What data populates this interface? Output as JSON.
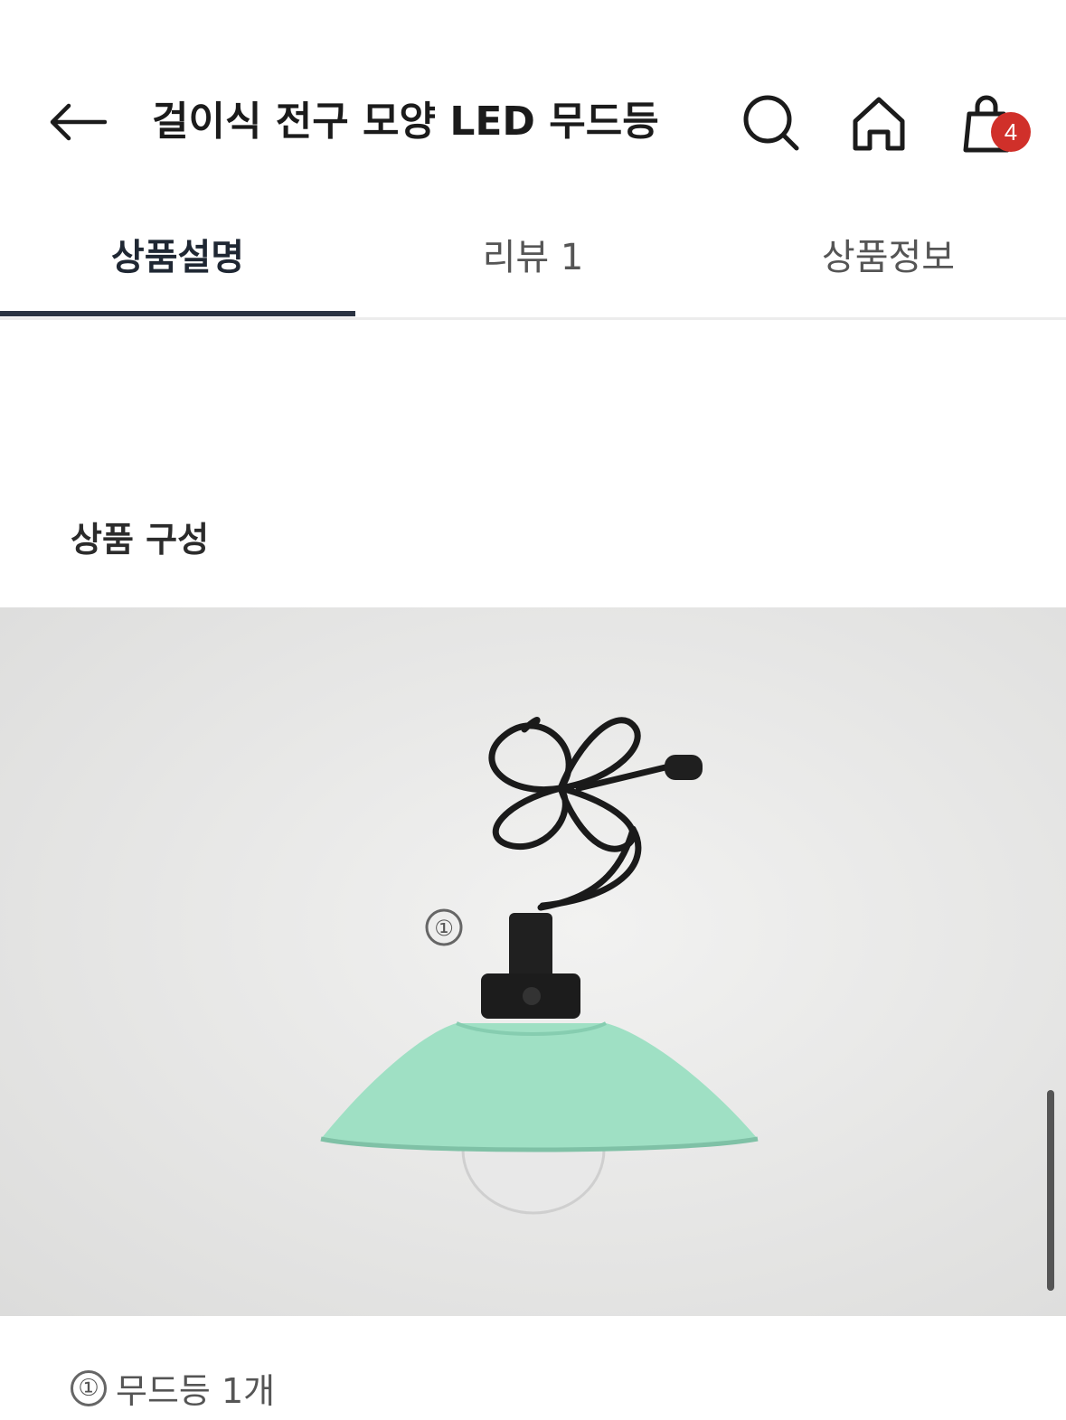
{
  "header": {
    "title": "걸이식 전구 모양 LED 무드등",
    "cart_badge_count": "4",
    "icons": [
      "back-arrow-icon",
      "search-icon",
      "home-icon",
      "shopping-bag-icon"
    ],
    "badge_color": "#d0302a"
  },
  "tabs": [
    {
      "label": "상품설명",
      "active": true
    },
    {
      "label": "리뷰 1",
      "active": false
    },
    {
      "label": "상품정보",
      "active": false
    }
  ],
  "content": {
    "section_title": "상품 구성",
    "image_marker": "①",
    "components": [
      {
        "marker": "①",
        "label": "무드등 1개"
      }
    ]
  },
  "colors": {
    "active_tab": "#2a3342",
    "lamp_shade": "#9fe0c4"
  }
}
